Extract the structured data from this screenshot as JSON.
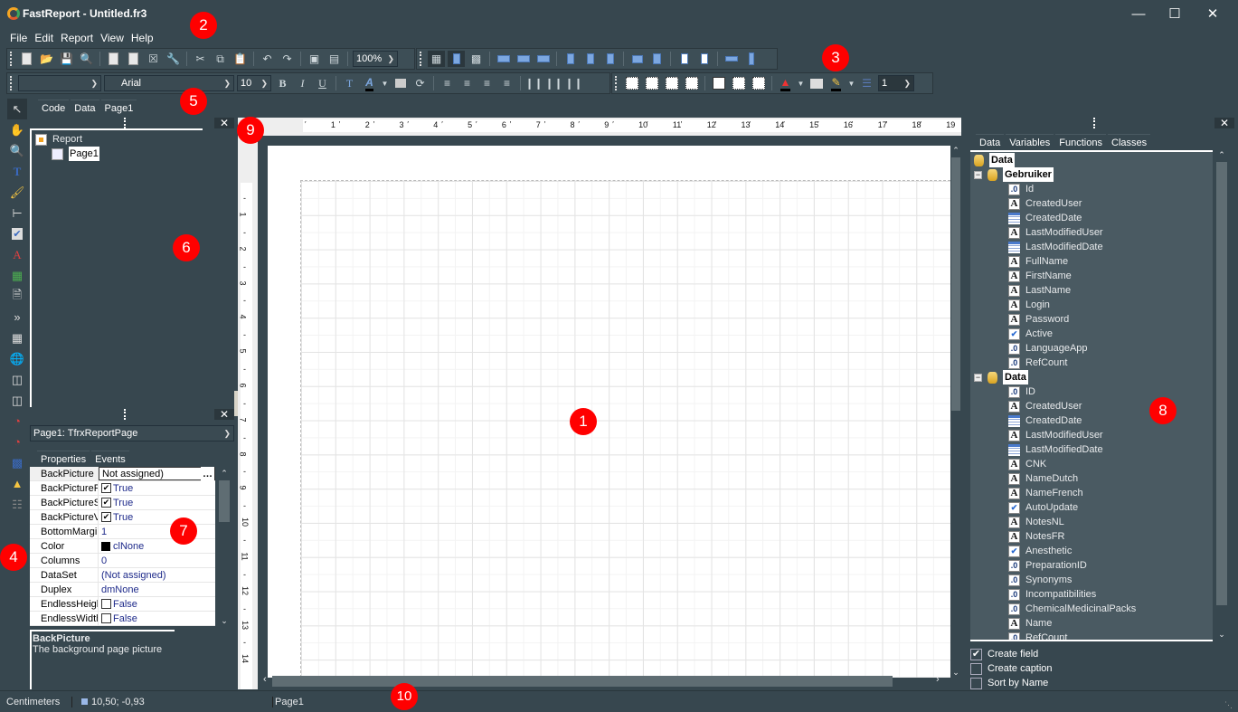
{
  "window": {
    "title": "FastReport - Untitled.fr3",
    "controls": [
      "minimize",
      "maximize",
      "close"
    ]
  },
  "menu": [
    "File",
    "Edit",
    "Report",
    "View",
    "Help"
  ],
  "toolbar1": {
    "zoom": "100%"
  },
  "toolbar2": {
    "style": "",
    "font": "Arial",
    "size": "10",
    "frame_width": "1"
  },
  "designer_tabs": [
    "Code",
    "Data",
    "Page1"
  ],
  "report_tree": {
    "root": "Report",
    "children": [
      "Page1"
    ]
  },
  "object_inspector": {
    "selector": "Page1: TfrxReportPage",
    "tabs": [
      "Properties",
      "Events"
    ],
    "properties": [
      {
        "name": "BackPicture",
        "value": "Not assigned)",
        "check": null,
        "editor": "..."
      },
      {
        "name": "BackPicturePrintable",
        "value": "True",
        "check": true
      },
      {
        "name": "BackPictureStretched",
        "value": "True",
        "check": true
      },
      {
        "name": "BackPictureVisible",
        "value": "True",
        "check": true
      },
      {
        "name": "BottomMargin",
        "value": "1",
        "check": null
      },
      {
        "name": "Color",
        "value": "clNone",
        "check": null,
        "swatch": "#000000"
      },
      {
        "name": "Columns",
        "value": "0",
        "check": null
      },
      {
        "name": "DataSet",
        "value": "(Not assigned)",
        "check": null
      },
      {
        "name": "Duplex",
        "value": "dmNone",
        "check": null
      },
      {
        "name": "EndlessHeight",
        "value": "False",
        "check": false
      },
      {
        "name": "EndlessWidth",
        "value": "False",
        "check": false
      }
    ],
    "hint_title": "BackPicture",
    "hint_text": "The background page picture"
  },
  "ruler": {
    "h": [
      "1",
      "2",
      "3",
      "4",
      "5",
      "6",
      "7",
      "8",
      "9",
      "10",
      "11",
      "12",
      "13",
      "14",
      "15",
      "16",
      "17",
      "18",
      "19"
    ],
    "v": [
      "1",
      "2",
      "3",
      "4",
      "5",
      "6",
      "7",
      "8",
      "9",
      "10",
      "11",
      "12",
      "13",
      "14"
    ]
  },
  "data_tree": {
    "tabs": [
      "Data",
      "Variables",
      "Functions",
      "Classes"
    ],
    "root": "Data",
    "datasets": [
      {
        "name": "Gebruiker",
        "fields": [
          {
            "name": "Id",
            "type": "num"
          },
          {
            "name": "CreatedUser",
            "type": "str"
          },
          {
            "name": "CreatedDate",
            "type": "date"
          },
          {
            "name": "LastModifiedUser",
            "type": "str"
          },
          {
            "name": "LastModifiedDate",
            "type": "date"
          },
          {
            "name": "FullName",
            "type": "str"
          },
          {
            "name": "FirstName",
            "type": "str"
          },
          {
            "name": "LastName",
            "type": "str"
          },
          {
            "name": "Login",
            "type": "str"
          },
          {
            "name": "Password",
            "type": "str"
          },
          {
            "name": "Active",
            "type": "bool"
          },
          {
            "name": "LanguageApp",
            "type": "num"
          },
          {
            "name": "RefCount",
            "type": "num"
          }
        ]
      },
      {
        "name": "Data",
        "fields": [
          {
            "name": "ID",
            "type": "num"
          },
          {
            "name": "CreatedUser",
            "type": "str"
          },
          {
            "name": "CreatedDate",
            "type": "date"
          },
          {
            "name": "LastModifiedUser",
            "type": "str"
          },
          {
            "name": "LastModifiedDate",
            "type": "date"
          },
          {
            "name": "CNK",
            "type": "str"
          },
          {
            "name": "NameDutch",
            "type": "str"
          },
          {
            "name": "NameFrench",
            "type": "str"
          },
          {
            "name": "AutoUpdate",
            "type": "bool"
          },
          {
            "name": "NotesNL",
            "type": "str"
          },
          {
            "name": "NotesFR",
            "type": "str"
          },
          {
            "name": "Anesthetic",
            "type": "bool"
          },
          {
            "name": "PreparationID",
            "type": "num"
          },
          {
            "name": "Synonyms",
            "type": "num"
          },
          {
            "name": "Incompatibilities",
            "type": "num"
          },
          {
            "name": "ChemicalMedicinalPacks",
            "type": "num"
          },
          {
            "name": "Name",
            "type": "str"
          },
          {
            "name": "RefCount",
            "type": "num"
          }
        ]
      }
    ],
    "options": [
      {
        "label": "Create field",
        "checked": true
      },
      {
        "label": "Create caption",
        "checked": false
      },
      {
        "label": "Sort by Name",
        "checked": false
      }
    ]
  },
  "status": {
    "units": "Centimeters",
    "coords": "10,50; -0,93",
    "page": "Page1"
  },
  "markers": [
    "1",
    "2",
    "3",
    "4",
    "5",
    "6",
    "7",
    "8",
    "9",
    "10"
  ],
  "colors": {
    "bg": "#37474f",
    "marker": "#ff0000"
  }
}
